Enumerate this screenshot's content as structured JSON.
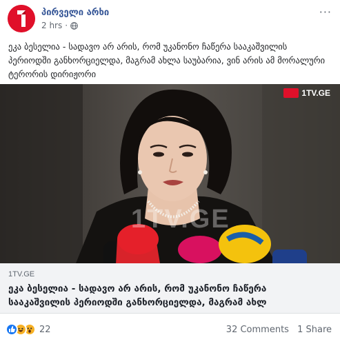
{
  "post": {
    "page_name": "პირველი არხი",
    "time": "2 hrs",
    "caption": "ეკა ბესელია - სადავო არ არის, რომ უკანონო ჩაწერა სააკაშვილის პერიოდში განხორციელდა, მაგრამ ახლა საუბარია, ვინ არის ამ მორალური ტერორის დირიჟორი",
    "menu_label": "···"
  },
  "photo": {
    "logo_text": "1TV.GE",
    "watermark": "1TV.GE"
  },
  "link": {
    "domain": "1TV.GE",
    "title": "ეკა ბესელია - სადავო არ არის, რომ უკანონო ჩაწერა სააკაშვილის პერიოდში განხორციელდა, მაგრამ ახლ"
  },
  "footer": {
    "reaction_count": "22",
    "comments": "32 Comments",
    "shares": "1 Share",
    "reaction_icons": [
      "like-icon",
      "haha-icon",
      "wow-icon"
    ]
  },
  "colors": {
    "brand": "#e0102a",
    "link_blue": "#385898"
  }
}
